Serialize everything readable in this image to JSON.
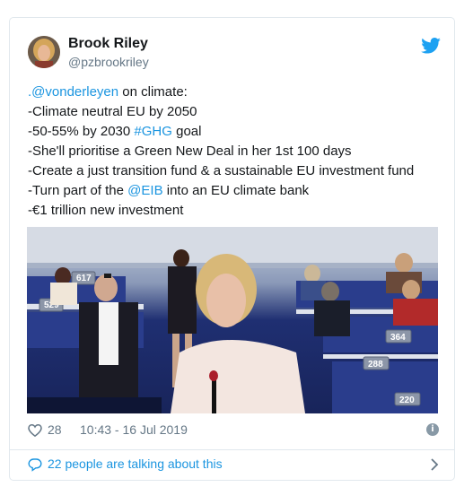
{
  "tweet": {
    "author_name": "Brook Riley",
    "author_handle": "@pzbrookriley",
    "lines": [
      {
        "mention": ".@vonderleyen",
        "text": " on climate:"
      },
      {
        "text": "-Climate neutral EU by 2050"
      },
      {
        "pre": "-50-55% by 2030 ",
        "hashtag": "#GHG",
        "post": " goal"
      },
      {
        "text": "-She'll prioritise a Green New Deal in her 1st 100 days"
      },
      {
        "text": "-Create a just transition fund & a sustainable EU investment fund"
      },
      {
        "pre": "-Turn part of the ",
        "mention": "@EIB",
        "post": " into an EU climate bank"
      },
      {
        "text": "-€1 trillion new investment"
      }
    ],
    "likes": "28",
    "timestamp": "10:43 - 16 Jul 2019",
    "info_icon": "i",
    "talking_label": "22 people are talking about this"
  },
  "media": {
    "seat_numbers": [
      "617",
      "529",
      "364",
      "288",
      "220"
    ]
  },
  "colors": {
    "link": "#1b95e0",
    "twitter_blue": "#1da1f2",
    "secondary_text": "#657786"
  }
}
